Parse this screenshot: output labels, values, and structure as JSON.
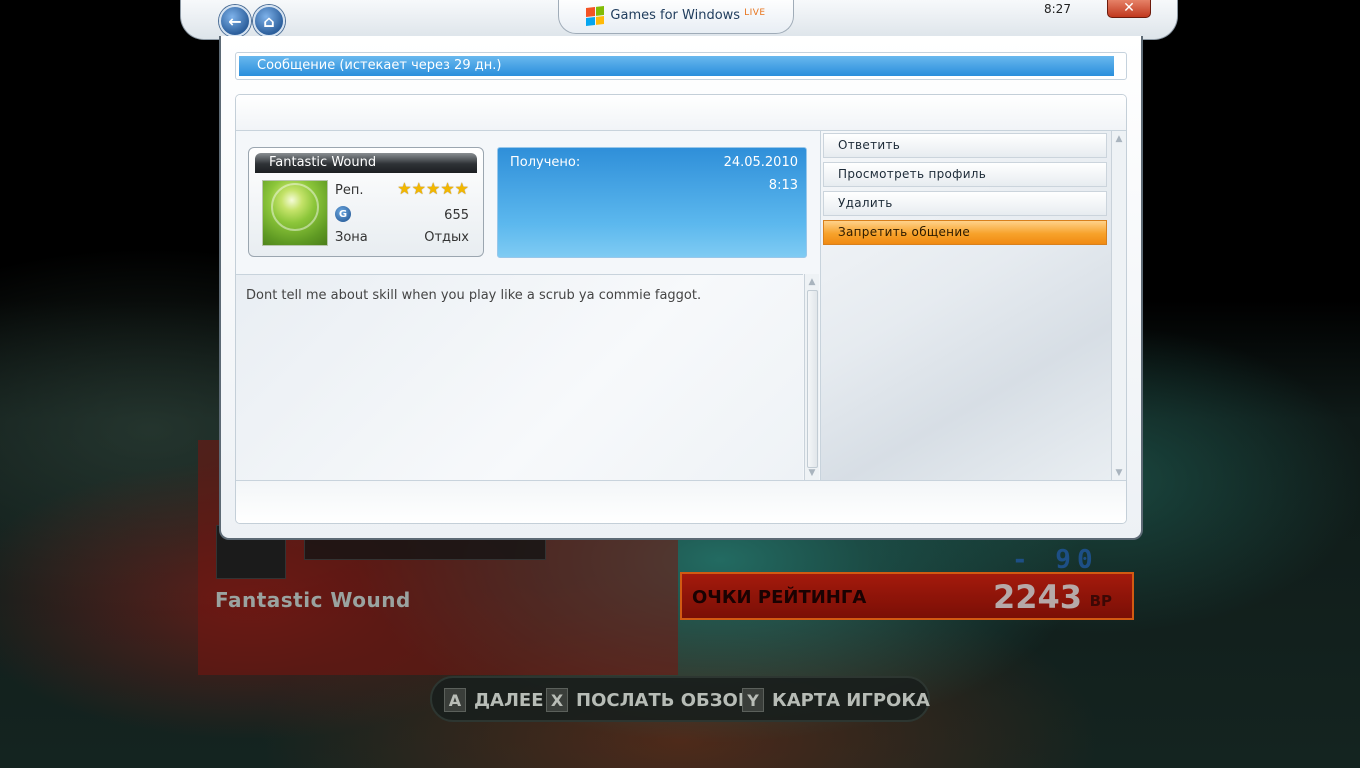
{
  "top_bar": {
    "back_label": "←",
    "home_label": "⌂",
    "logo_text": "Games for Windows",
    "logo_live": "LIVE",
    "clock": "8:27",
    "close_label": "✕"
  },
  "dialog": {
    "header_title": "Сообщение (истекает через 29 дн.)"
  },
  "gamercard": {
    "gamertag": "Fantastic Wound",
    "rep_label": "Реп.",
    "rep_stars": 5,
    "gamerscore": "655",
    "zone_label": "Зона",
    "zone_value": "Отдых",
    "g_icon_label": "G"
  },
  "received": {
    "label": "Получено:",
    "date": "24.05.2010",
    "time": "8:13"
  },
  "message": {
    "body": "Dont tell me about skill when you play like a scrub ya commie faggot."
  },
  "actions": [
    {
      "label": "Ответить",
      "selected": false
    },
    {
      "label": "Просмотреть профиль",
      "selected": false
    },
    {
      "label": "Удалить",
      "selected": false
    },
    {
      "label": "Запретить общение",
      "selected": true
    }
  ],
  "background_game": {
    "gamertag": "Fantastic Wound",
    "minus_value": "- 90",
    "rating_label": "ОЧКИ РЕЙТИНГА",
    "rating_value": "2243",
    "rating_unit": "BP",
    "controls": [
      {
        "key": "A",
        "label": "ДАЛЕЕ"
      },
      {
        "key": "X",
        "label": "ПОСЛАТЬ ОБЗОР"
      },
      {
        "key": "Y",
        "label": "КАРТА ИГРОКА"
      }
    ]
  },
  "colors": {
    "accent_blue": "#2a8fdc",
    "selected_orange": "#f7a22b",
    "star_gold": "#f2b700"
  },
  "icons": {
    "back": "back-arrow-icon",
    "home": "home-icon",
    "close": "close-icon",
    "windows_logo": "windows-flag-icon",
    "gamerscore": "gamerscore-g-icon",
    "star": "star-icon"
  }
}
